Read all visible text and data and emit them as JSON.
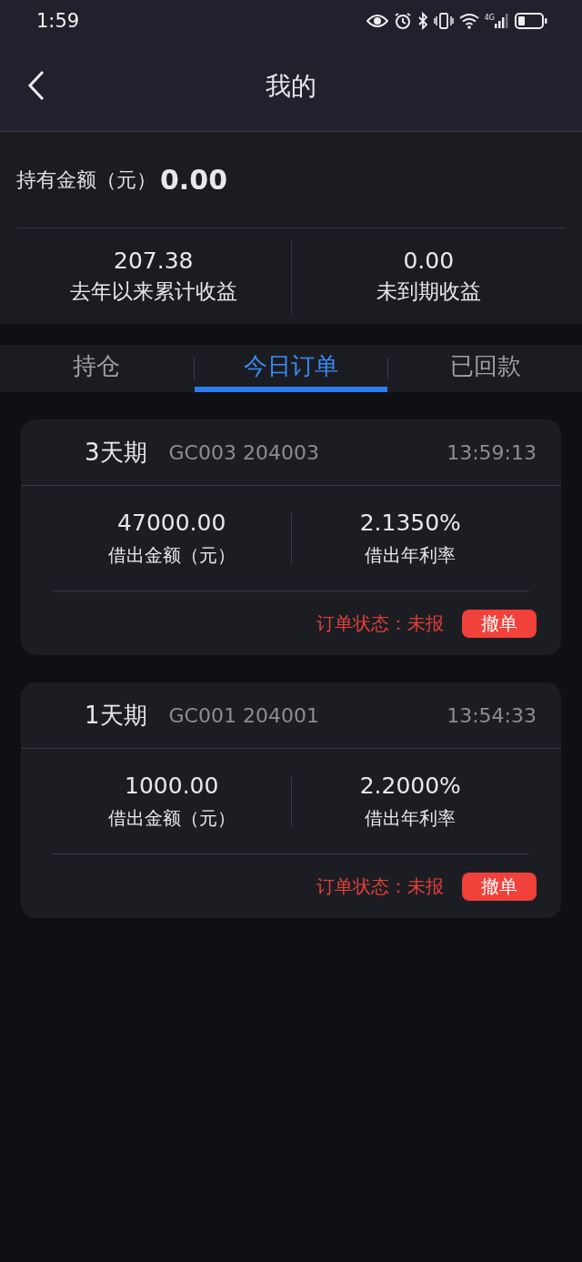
{
  "status_bar": {
    "time": "1:59",
    "network": "4G"
  },
  "header": {
    "title": "我的"
  },
  "summary": {
    "holding_label": "持有金额（元）",
    "holding_value": "0.00",
    "stats": [
      {
        "value": "207.38",
        "label": "去年以来累计收益"
      },
      {
        "value": "0.00",
        "label": "未到期收益"
      }
    ]
  },
  "tabs": [
    {
      "label": "持仓",
      "selected": false
    },
    {
      "label": "今日订单",
      "selected": true
    },
    {
      "label": "已回款",
      "selected": false
    }
  ],
  "orders": [
    {
      "term": "3天期",
      "code": "GC003 204003",
      "time": "13:59:13",
      "amount": "47000.00",
      "amount_label": "借出金额（元）",
      "rate": "2.1350%",
      "rate_label": "借出年利率",
      "status": "订单状态：未报",
      "action": "撤单"
    },
    {
      "term": "1天期",
      "code": "GC001 204001",
      "time": "13:54:33",
      "amount": "1000.00",
      "amount_label": "借出金额（元）",
      "rate": "2.2000%",
      "rate_label": "借出年利率",
      "status": "订单状态：未报",
      "action": "撤单"
    }
  ]
}
